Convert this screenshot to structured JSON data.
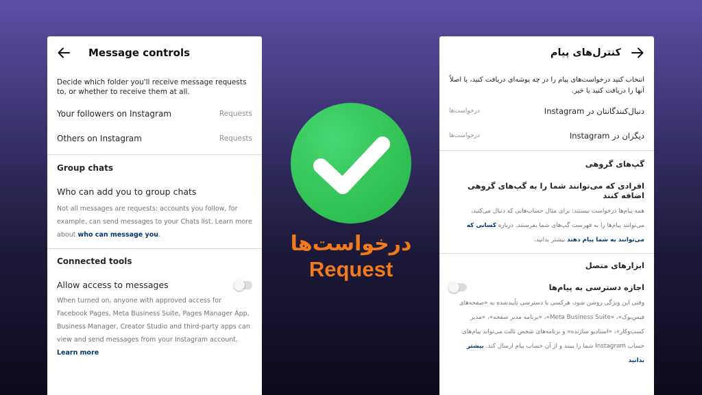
{
  "colors": {
    "accent_green": "#33c356",
    "accent_orange": "#f07a1c",
    "link_blue": "#00376b"
  },
  "left": {
    "header": {
      "title": "Message controls",
      "back_icon": "arrow-left-icon"
    },
    "intro": "Decide which folder you'll receive message requests to, or whether to receive them at all.",
    "rows": [
      {
        "label": "Your followers on Instagram",
        "value": "Requests"
      },
      {
        "label": "Others on Instagram",
        "value": "Requests"
      }
    ],
    "group_chats": {
      "title": "Group chats",
      "who_can_add": "Who can add you to group chats",
      "note": "Not all messages are requests: accounts you follow, for example, can send messages to your Chats list. Learn more about ",
      "note_link": "who can message you",
      "note_end": "."
    },
    "connected_tools": {
      "title": "Connected tools",
      "allow_access": "Allow access to messages",
      "toggle_on": false,
      "note": "When turned on, anyone with approved access for Facebook Pages, Meta Business Suite, Pages Manager App, Business Manager, Creator Studio and third-party apps can view and send messages from your Instagram account. ",
      "note_link": "Learn more"
    }
  },
  "right": {
    "header": {
      "title": "کنترل‌های پیام",
      "back_icon": "arrow-right-icon"
    },
    "intro": "انتخاب کنید درخواست‌های پیام را در چه پوشه‌ای دریافت کنید، یا اصلاً آنها را دریافت کنید یا خیر.",
    "rows": [
      {
        "label": "دنبال‌کنندگانتان در Instagram",
        "value": "درخواست‌ها"
      },
      {
        "label": "دیگران در Instagram",
        "value": "درخواست‌ها"
      }
    ],
    "group_chats": {
      "title": "گپ‌های گروهی",
      "who_can_add": "افرادی که می‌توانند شما را به گپ‌های گروهی اضافه کنند",
      "note": "همه پیام‌ها درخواست نیستند: برای مثال حساب‌هایی که دنبال می‌کنید، می‌توانند پیام‌ها را به فهرست گپ‌های شما بفرستند. درباره ",
      "note_link": "کسانی که می‌توانند به شما پیام دهند",
      "note_end": " بیشتر بدانید."
    },
    "connected_tools": {
      "title": "ابزارهای متصل",
      "allow_access": "اجازه دسترسی به پیام‌ها",
      "toggle_on": false,
      "note": "وقتی این ویژگی روشن شود، هرکسی با دسترسی تأییدشده به «صفحه‌های فیس‌بوک»، «Meta Business Suite»، «برنامه مدیر صفحه»، «مدیر کسب‌وکار»، «استادیو سازنده» و برنامه‌های شخص ثالث می‌تواند پیام‌های حساب Instagram شما را ببیند و از آن حساب پیام ارسال کند. ",
      "note_link": "بیشتر بدانید"
    }
  },
  "center": {
    "icon": "check-circle-icon",
    "title_fa": "درخواست‌ها",
    "title_en": "Request"
  }
}
